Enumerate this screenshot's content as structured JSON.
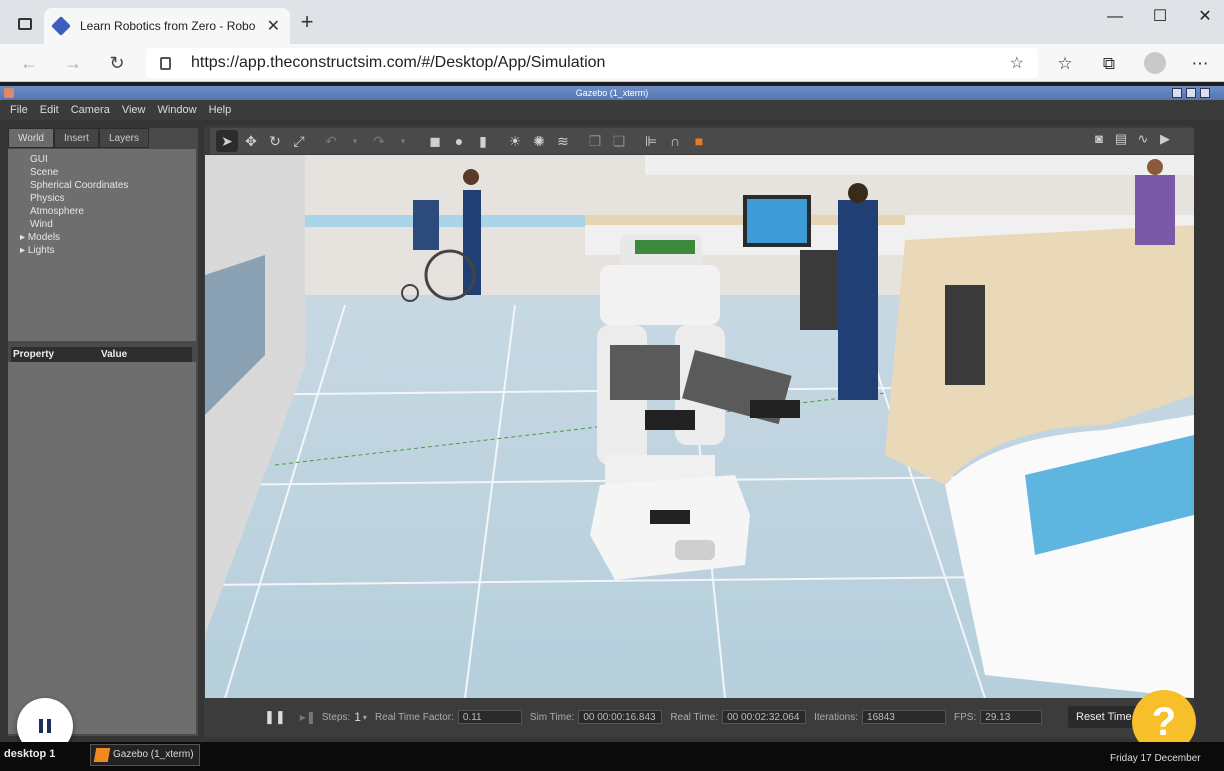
{
  "browser": {
    "tab_title": "Learn Robotics from Zero - Robo",
    "url": "https://app.theconstructsim.com/#/Desktop/App/Simulation",
    "new_tab": "+",
    "minimize": "—",
    "maximize": "☐",
    "close": "✕"
  },
  "gazebo": {
    "window_title": "Gazebo (1_xterm)",
    "menu": [
      "File",
      "Edit",
      "Camera",
      "View",
      "Window",
      "Help"
    ],
    "tabs": [
      "World",
      "Insert",
      "Layers"
    ],
    "tree": {
      "top": [
        "GUI",
        "Scene",
        "Spherical Coordinates",
        "Physics",
        "Atmosphere",
        "Wind"
      ],
      "expandable": [
        "Models",
        "Lights"
      ]
    },
    "property_header": "Property",
    "value_header": "Value",
    "status": {
      "steps_label": "Steps:",
      "steps_value": "1",
      "rtf_label": "Real Time Factor:",
      "rtf_value": "0.11",
      "sim_time_label": "Sim Time:",
      "sim_time_value": "00 00:00:16.843",
      "real_time_label": "Real Time:",
      "real_time_value": "00 00:02:32.064",
      "iterations_label": "Iterations:",
      "iterations_value": "16843",
      "fps_label": "FPS:",
      "fps_value": "29.13",
      "reset_time": "Reset Time"
    }
  },
  "help_label": "?",
  "taskbar": {
    "desktop": "desktop 1",
    "app": "Gazebo (1_xterm)",
    "date": "Friday 17 December"
  }
}
